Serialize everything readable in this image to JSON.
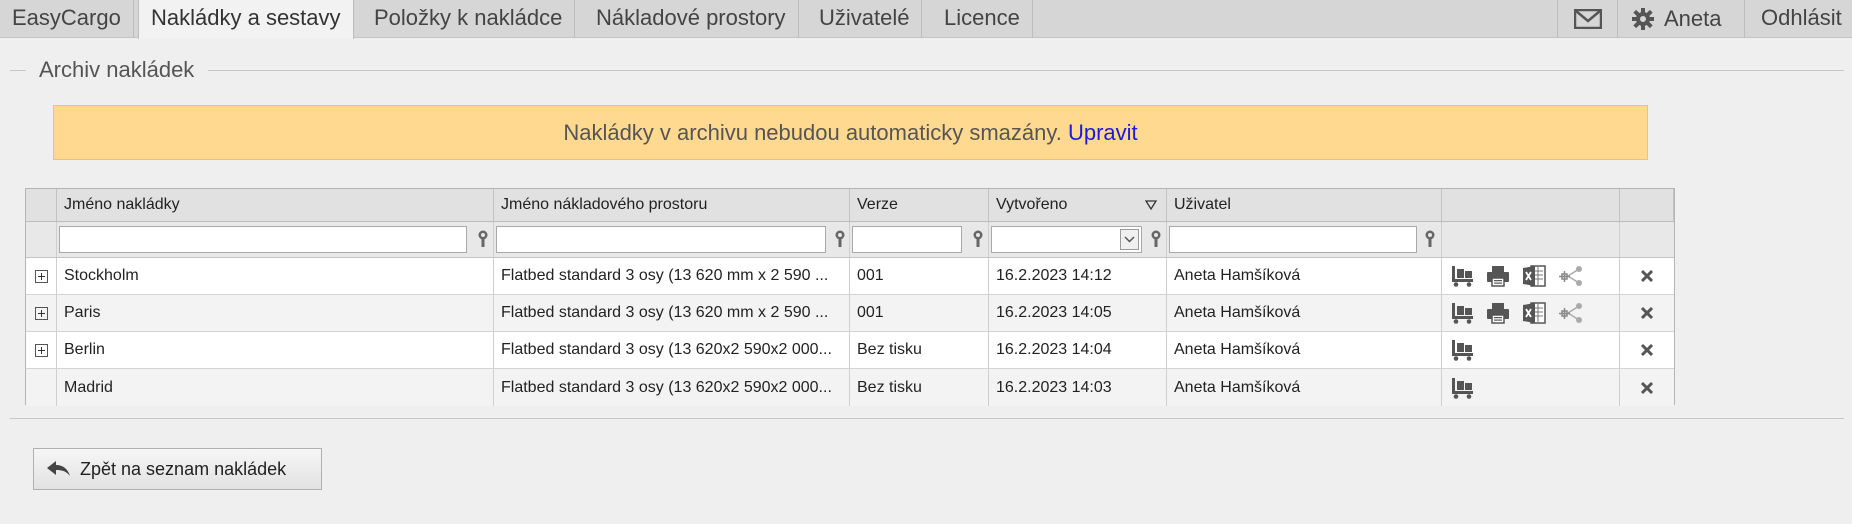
{
  "nav": {
    "app_name": "EasyCargo",
    "tabs": [
      {
        "label": "Nakládky a sestavy"
      },
      {
        "label": "Položky k nakládce"
      },
      {
        "label": "Nákladové prostory"
      },
      {
        "label": "Uživatelé"
      },
      {
        "label": "Licence"
      }
    ],
    "user_name": "Aneta",
    "logout_label": "Odhlásit"
  },
  "section": {
    "title": "Archiv nakládek"
  },
  "notice": {
    "text": "Nakládky v archivu nebudou automaticky smazány.",
    "link": "Upravit"
  },
  "grid": {
    "columns": [
      "Jméno nakládky",
      "Jméno nákladového prostoru",
      "Verze",
      "Vytvořeno",
      "Uživatel"
    ],
    "filters": [
      "",
      "",
      "",
      "",
      ""
    ],
    "rows": [
      {
        "name": "Stockholm",
        "space": "Flatbed standard 3 osy (13 620 mm x 2 590 ...",
        "version": "001",
        "created": "16.2.2023 14:12",
        "user": "Aneta Hamšíková"
      },
      {
        "name": "Paris",
        "space": "Flatbed standard 3 osy (13 620 mm x 2 590 ...",
        "version": "001",
        "created": "16.2.2023 14:05",
        "user": "Aneta Hamšíková"
      },
      {
        "name": "Berlin",
        "space": "Flatbed standard 3 osy (13 620x2 590x2 000...",
        "version": "Bez tisku",
        "created": "16.2.2023 14:04",
        "user": "Aneta Hamšíková"
      },
      {
        "name": "Madrid",
        "space": "Flatbed standard 3 osy (13 620x2 590x2 000...",
        "version": "Bez tisku",
        "created": "16.2.2023 14:03",
        "user": "Aneta Hamšíková"
      }
    ]
  },
  "footer": {
    "back_label": "Zpět na seznam nakládek"
  }
}
